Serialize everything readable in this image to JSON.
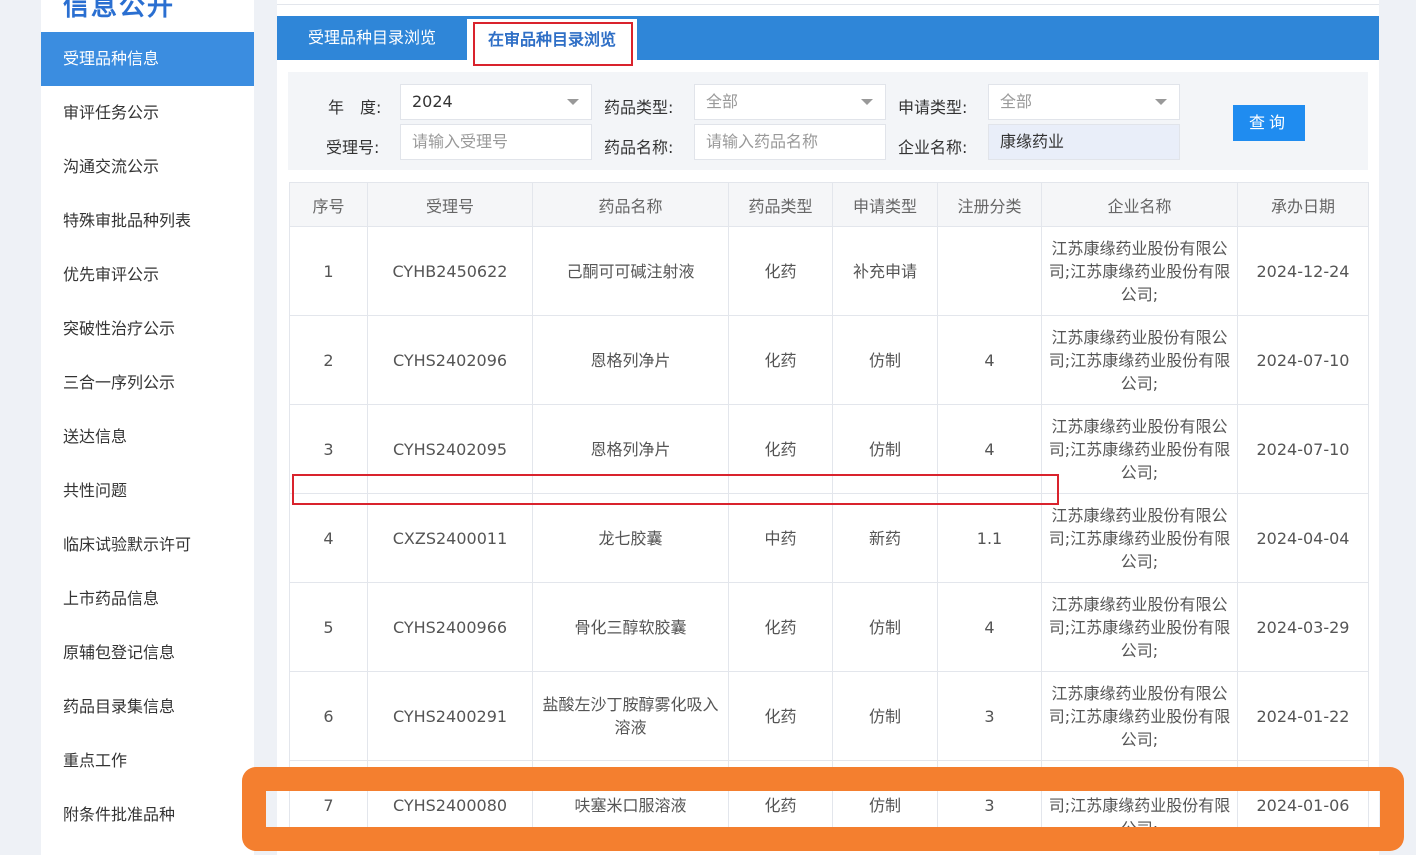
{
  "sidebar": {
    "title": "信息公开",
    "items": [
      {
        "label": "受理品种信息",
        "active": true
      },
      {
        "label": "审评任务公示"
      },
      {
        "label": "沟通交流公示"
      },
      {
        "label": "特殊审批品种列表"
      },
      {
        "label": "优先审评公示"
      },
      {
        "label": "突破性治疗公示"
      },
      {
        "label": "三合一序列公示"
      },
      {
        "label": "送达信息"
      },
      {
        "label": "共性问题"
      },
      {
        "label": "临床试验默示许可"
      },
      {
        "label": "上市药品信息"
      },
      {
        "label": "原辅包登记信息"
      },
      {
        "label": "药品目录集信息"
      },
      {
        "label": "重点工作"
      },
      {
        "label": "附条件批准品种"
      }
    ]
  },
  "tabs": {
    "tab1": "受理品种目录浏览",
    "tab2": "在审品种目录浏览"
  },
  "filter": {
    "year_label": "年　度:",
    "year_value": "2024",
    "drug_type_label": "药品类型:",
    "drug_type_value": "全部",
    "apply_type_label": "申请类型:",
    "apply_type_value": "全部",
    "accept_no_label": "受理号:",
    "accept_no_placeholder": "请输入受理号",
    "drug_name_label": "药品名称:",
    "drug_name_placeholder": "请输入药品名称",
    "company_label": "企业名称:",
    "company_value": "康缘药业",
    "query_button": "查询"
  },
  "table": {
    "headers": [
      "序号",
      "受理号",
      "药品名称",
      "药品类型",
      "申请类型",
      "注册分类",
      "企业名称",
      "承办日期"
    ],
    "rows": [
      {
        "no": "1",
        "accept_no": "CYHB2450622",
        "drug_name": "己酮可可碱注射液",
        "drug_type": "化药",
        "apply_type": "补充申请",
        "reg_class": "",
        "company": "江苏康缘药业股份有限公司;江苏康缘药业股份有限公司;",
        "date": "2024-12-24"
      },
      {
        "no": "2",
        "accept_no": "CYHS2402096",
        "drug_name": "恩格列净片",
        "drug_type": "化药",
        "apply_type": "仿制",
        "reg_class": "4",
        "company": "江苏康缘药业股份有限公司;江苏康缘药业股份有限公司;",
        "date": "2024-07-10"
      },
      {
        "no": "3",
        "accept_no": "CYHS2402095",
        "drug_name": "恩格列净片",
        "drug_type": "化药",
        "apply_type": "仿制",
        "reg_class": "4",
        "company": "江苏康缘药业股份有限公司;江苏康缘药业股份有限公司;",
        "date": "2024-07-10"
      },
      {
        "no": "4",
        "accept_no": "CXZS2400011",
        "drug_name": "龙七胶囊",
        "drug_type": "中药",
        "apply_type": "新药",
        "reg_class": "1.1",
        "company": "江苏康缘药业股份有限公司;江苏康缘药业股份有限公司;",
        "date": "2024-04-04"
      },
      {
        "no": "5",
        "accept_no": "CYHS2400966",
        "drug_name": "骨化三醇软胶囊",
        "drug_type": "化药",
        "apply_type": "仿制",
        "reg_class": "4",
        "company": "江苏康缘药业股份有限公司;江苏康缘药业股份有限公司;",
        "date": "2024-03-29"
      },
      {
        "no": "6",
        "accept_no": "CYHS2400291",
        "drug_name": "盐酸左沙丁胺醇雾化吸入溶液",
        "drug_type": "化药",
        "apply_type": "仿制",
        "reg_class": "3",
        "company": "江苏康缘药业股份有限公司;江苏康缘药业股份有限公司;",
        "date": "2024-01-22"
      },
      {
        "no": "7",
        "accept_no": "CYHS2400080",
        "drug_name": "呋塞米口服溶液",
        "drug_type": "化药",
        "apply_type": "仿制",
        "reg_class": "3",
        "company": "江苏康缘药业股份有限公司;江苏康缘药业股份有限公司;",
        "date": "2024-01-06"
      }
    ]
  },
  "colors": {
    "accent": "#2f86d8",
    "sidebar_active": "#3b8de0",
    "annotation_red": "#d9232d",
    "annotation_orange": "#f47f2f"
  }
}
